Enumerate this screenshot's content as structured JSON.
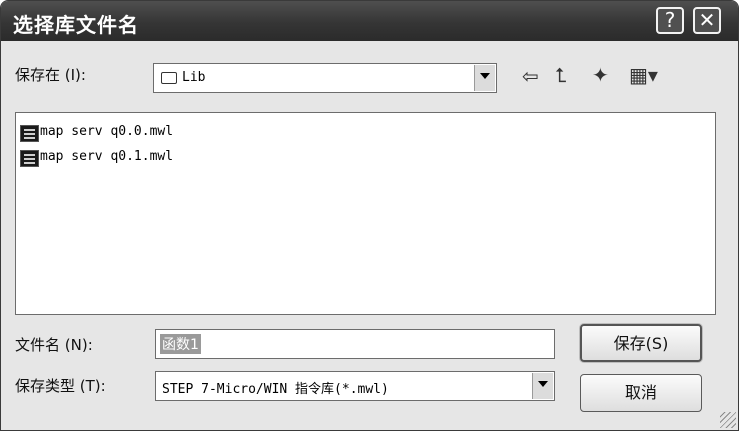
{
  "window": {
    "title": "选择库文件名",
    "help_label": "?",
    "close_label": "✕"
  },
  "save_in": {
    "label": "保存在 (I):",
    "value": "Lib",
    "folder_icon": "folder-icon"
  },
  "toolbar": {
    "back_icon": "back-arrow-icon",
    "up_icon": "up-folder-icon",
    "new_folder_icon": "new-folder-icon",
    "view_menu_icon": "view-menu-icon",
    "back_glyph": "⇦",
    "up_glyph": "⮤",
    "new_folder_glyph": "✦",
    "view_glyph": "▦▾"
  },
  "files": [
    {
      "name": "map serv q0.0.mwl",
      "icon": "library-file-icon"
    },
    {
      "name": "map serv q0.1.mwl",
      "icon": "library-file-icon"
    }
  ],
  "filename": {
    "label": "文件名 (N):",
    "value": "函数1"
  },
  "filetype": {
    "label": "保存类型 (T):",
    "value": "STEP 7-Micro/WIN 指令库(*.mwl)"
  },
  "buttons": {
    "save_label": "保存(S)",
    "cancel_label": "取消"
  }
}
